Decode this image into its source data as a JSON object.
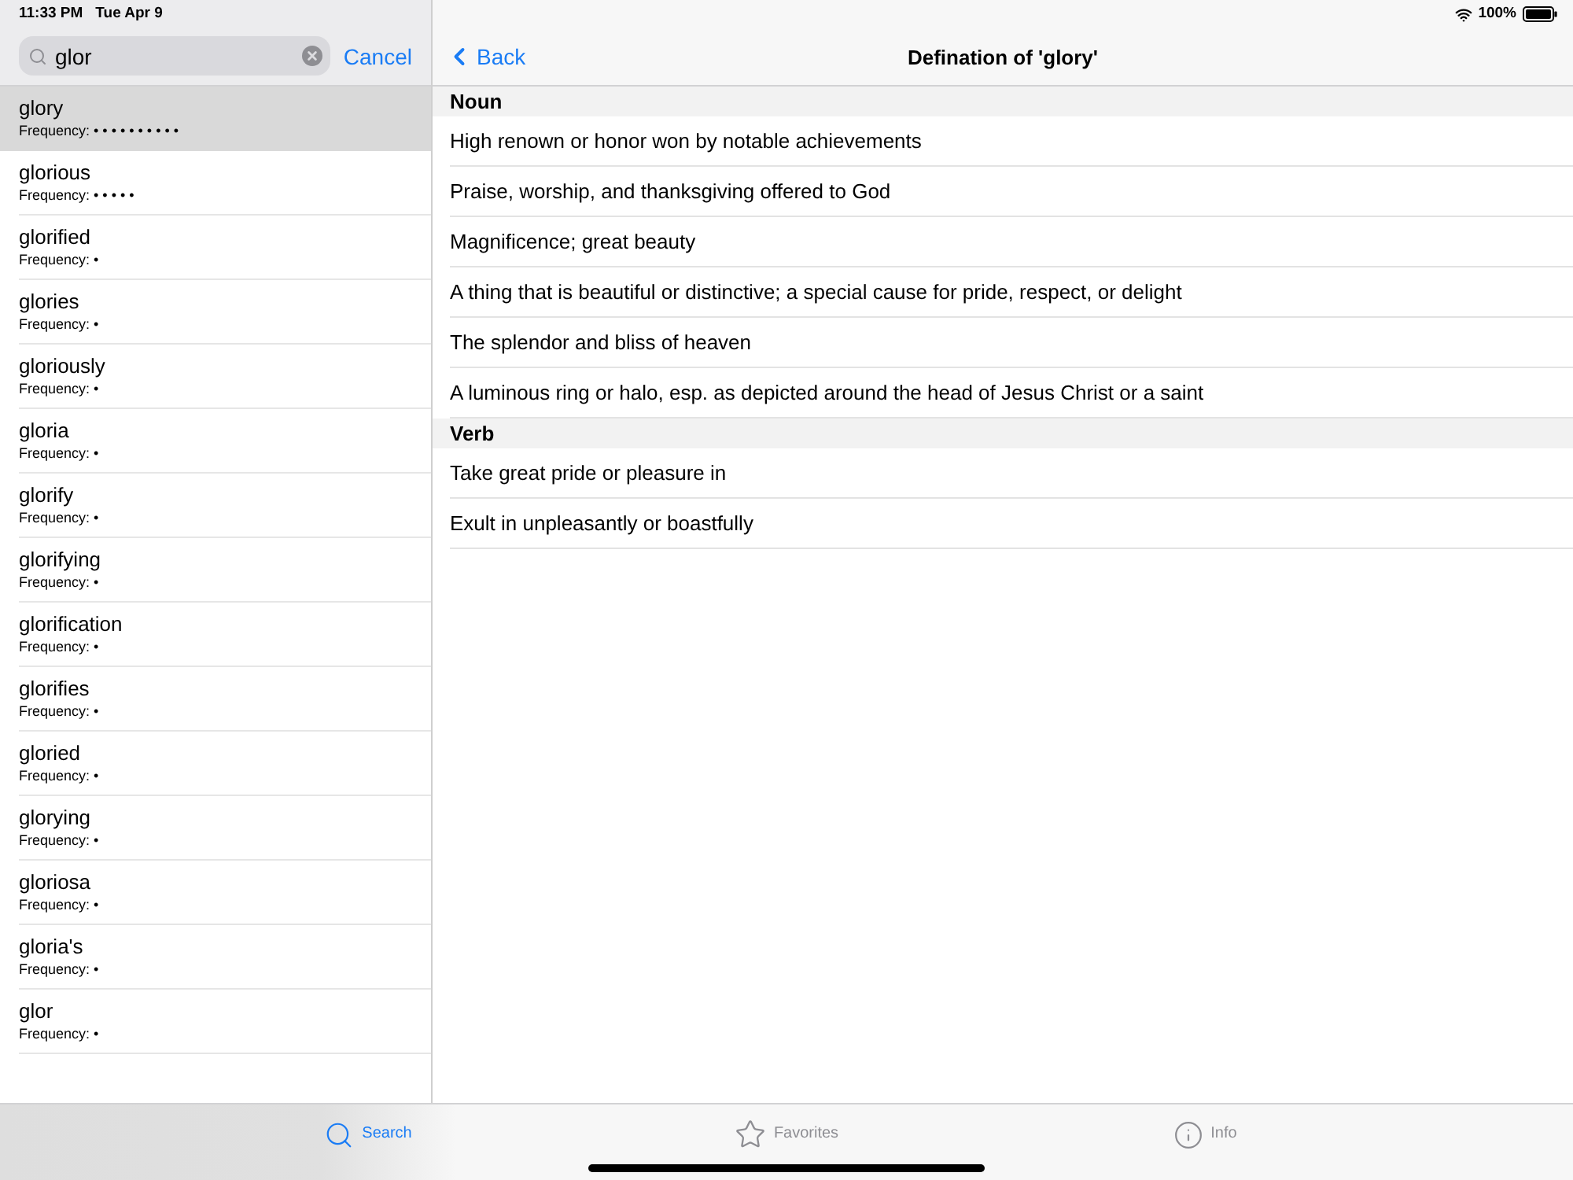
{
  "status_bar": {
    "time": "11:33 PM",
    "date": "Tue Apr 9",
    "battery": "100%"
  },
  "search": {
    "value": "glor",
    "cancel": "Cancel"
  },
  "results": [
    {
      "word": "glory",
      "frequency": "Frequency: • • • • • • • • • •",
      "selected": true
    },
    {
      "word": "glorious",
      "frequency": "Frequency: • • • • •",
      "selected": false
    },
    {
      "word": "glorified",
      "frequency": "Frequency: •",
      "selected": false
    },
    {
      "word": "glories",
      "frequency": "Frequency: •",
      "selected": false
    },
    {
      "word": "gloriously",
      "frequency": "Frequency: •",
      "selected": false
    },
    {
      "word": "gloria",
      "frequency": "Frequency: •",
      "selected": false
    },
    {
      "word": "glorify",
      "frequency": "Frequency: •",
      "selected": false
    },
    {
      "word": "glorifying",
      "frequency": "Frequency: •",
      "selected": false
    },
    {
      "word": "glorification",
      "frequency": "Frequency: •",
      "selected": false
    },
    {
      "word": "glorifies",
      "frequency": "Frequency: •",
      "selected": false
    },
    {
      "word": "gloried",
      "frequency": "Frequency: •",
      "selected": false
    },
    {
      "word": "glorying",
      "frequency": "Frequency: •",
      "selected": false
    },
    {
      "word": "gloriosa",
      "frequency": "Frequency: •",
      "selected": false
    },
    {
      "word": "gloria's",
      "frequency": "Frequency: •",
      "selected": false
    },
    {
      "word": "glor",
      "frequency": "Frequency: •",
      "selected": false
    }
  ],
  "nav": {
    "back": "Back",
    "title": "Defination of 'glory'"
  },
  "sections": [
    {
      "heading": "Noun",
      "definitions": [
        "High renown or honor won by notable achievements",
        "Praise, worship, and thanksgiving offered to God",
        "Magnificence; great beauty",
        "A thing that is beautiful or distinctive; a special cause for pride, respect, or delight",
        "The splendor and bliss of heaven",
        "A luminous ring or halo, esp. as depicted around the head of Jesus Christ or a saint"
      ]
    },
    {
      "heading": "Verb",
      "definitions": [
        "Take great pride or pleasure in",
        "Exult in unpleasantly or boastfully"
      ]
    }
  ],
  "tabs": [
    {
      "kind": "search",
      "label": "Search",
      "selected": true
    },
    {
      "kind": "favorites",
      "label": "Favorites",
      "selected": false
    },
    {
      "kind": "info",
      "label": "Info",
      "selected": false
    }
  ]
}
